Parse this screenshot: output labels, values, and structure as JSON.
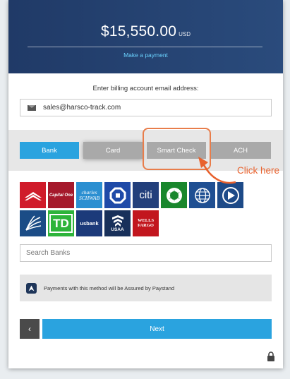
{
  "header": {
    "amount": "$15,550.00",
    "currency": "USD",
    "link_label": "Make a payment"
  },
  "billing": {
    "label": "Enter billing account email address:",
    "email_value": "sales@harsco-track.com"
  },
  "tabs": [
    {
      "label": "Bank",
      "active": true
    },
    {
      "label": "Card",
      "active": false
    },
    {
      "label": "Smart Check",
      "active": false
    },
    {
      "label": "ACH",
      "active": false
    }
  ],
  "banks": [
    {
      "name": "bank-of-america",
      "bg": "#d01b2a"
    },
    {
      "name": "capital-one",
      "text": "Capital One",
      "bg": "#a5192b"
    },
    {
      "name": "charles-schwab",
      "text": "charles SCHWAB",
      "bg": "#2b8fd1"
    },
    {
      "name": "chase",
      "bg": "#1f4aa8"
    },
    {
      "name": "citi",
      "text": "citi",
      "bg": "#223f7b"
    },
    {
      "name": "fifth-third",
      "bg": "#19872d"
    },
    {
      "name": "hsbc-globe",
      "bg": "#1f4f92"
    },
    {
      "name": "pnc",
      "bg": "#1d4a88"
    },
    {
      "name": "regions",
      "bg": "#1b4c86"
    },
    {
      "name": "td",
      "text": "TD",
      "bg": "#2db43a"
    },
    {
      "name": "us-bank",
      "text": "usbank",
      "bg": "#1c3a7a"
    },
    {
      "name": "usaa",
      "text": "USAA",
      "bg": "#18305a"
    },
    {
      "name": "wells-fargo",
      "text": "WELLS FARGO",
      "bg": "#c2161e"
    }
  ],
  "search": {
    "placeholder": "Search Banks"
  },
  "assurance": {
    "text": "Payments with this method will be Assured by Paystand"
  },
  "buttons": {
    "back_label": "‹",
    "next_label": "Next"
  },
  "annotation": {
    "label": "Click here",
    "color": "#e8622e"
  }
}
